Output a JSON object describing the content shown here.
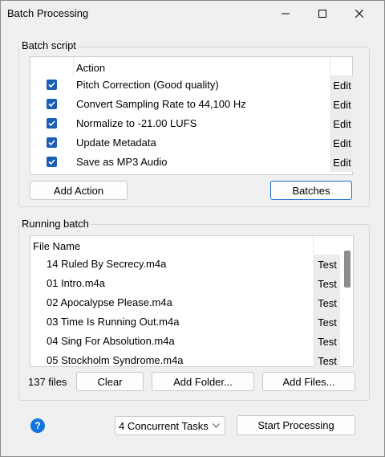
{
  "window": {
    "title": "Batch Processing"
  },
  "batch_script": {
    "label": "Batch script",
    "column_header": "Action",
    "actions": [
      {
        "label": "Pitch Correction (Good quality)",
        "checked": true,
        "edit_label": "Edit"
      },
      {
        "label": "Convert Sampling Rate to 44,100 Hz",
        "checked": true,
        "edit_label": "Edit"
      },
      {
        "label": "Normalize to -21.00 LUFS",
        "checked": true,
        "edit_label": "Edit"
      },
      {
        "label": "Update Metadata",
        "checked": true,
        "edit_label": "Edit"
      },
      {
        "label": "Save as MP3 Audio",
        "checked": true,
        "edit_label": "Edit"
      }
    ],
    "add_action_label": "Add Action",
    "batches_label": "Batches"
  },
  "running_batch": {
    "label": "Running batch",
    "column_header": "File Name",
    "files": [
      {
        "name": "14 Ruled By Secrecy.m4a",
        "test_label": "Test"
      },
      {
        "name": "01 Intro.m4a",
        "test_label": "Test"
      },
      {
        "name": "02 Apocalypse Please.m4a",
        "test_label": "Test"
      },
      {
        "name": "03 Time Is Running Out.m4a",
        "test_label": "Test"
      },
      {
        "name": "04 Sing For Absolution.m4a",
        "test_label": "Test"
      },
      {
        "name": "05 Stockholm Syndrome.m4a",
        "test_label": "Test"
      }
    ],
    "file_count": "137 files",
    "clear_label": "Clear",
    "add_folder_label": "Add Folder...",
    "add_files_label": "Add Files..."
  },
  "footer": {
    "help_glyph": "?",
    "concurrency_selected": "4 Concurrent Tasks",
    "start_label": "Start Processing"
  },
  "colors": {
    "accent": "#1a5fb4",
    "help": "#1273de"
  }
}
